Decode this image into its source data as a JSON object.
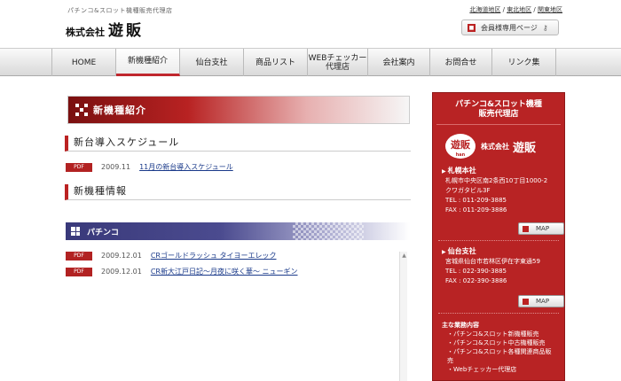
{
  "header": {
    "tagline": "パチンコ&スロット機種販売代理店",
    "company_prefix": "株式会社",
    "company_name": "遊販",
    "branches": [
      "北海道地区",
      "東北地区",
      "関東地区"
    ],
    "member_button": "会員様専用ページ"
  },
  "nav": {
    "items": [
      {
        "label": "HOME",
        "width": 72
      },
      {
        "label": "新機種紹介",
        "width": 72
      },
      {
        "label": "仙台支社",
        "width": 72
      },
      {
        "label": "商品リスト",
        "width": 72
      },
      {
        "label": "WEBチェッカー\n代理店",
        "width": 68
      },
      {
        "label": "会社案内",
        "width": 70
      },
      {
        "label": "お問合せ",
        "width": 70
      },
      {
        "label": "リンク集",
        "width": 72
      }
    ],
    "active_index": 1
  },
  "main": {
    "page_title": "新機種紹介",
    "schedule_title": "新台導入スケジュール",
    "pdf_label": "PDF",
    "schedule_rows": [
      {
        "date": "2009.11",
        "link": "11月の新台導入スケジュール"
      }
    ],
    "new_models_title": "新機種情報",
    "pachinko_label": "パチンコ",
    "pachinko_rows": [
      {
        "date": "2009.12.01",
        "link": "CRゴールドラッシュ タイヨーエレック"
      },
      {
        "date": "2009.12.01",
        "link": "CR新大江戸日記〜月夜に咲く華〜 ニューギン"
      }
    ]
  },
  "sidebar": {
    "heading_line1": "パチンコ&スロット機種",
    "heading_line2": "販売代理店",
    "logo_char": "遊販",
    "logo_sub": "han",
    "company_prefix": "株式会社",
    "company_name": "遊販",
    "offices": [
      {
        "name": "札幌本社",
        "address1": "札幌市中央区南2条西10丁目1000-2",
        "address2": "クワガタビル3F",
        "tel": "TEL : 011-209-3885",
        "fax": "FAX : 011-209-3886",
        "map": "MAP"
      },
      {
        "name": "仙台支社",
        "address1": "宮城県仙台市若林区伊在字東通59",
        "address2": "",
        "tel": "TEL : 022-390-3885",
        "fax": "FAX : 022-390-3886",
        "map": "MAP"
      }
    ],
    "services_title": "主な業務内容",
    "services": [
      "パチンコ&スロット新機種販売",
      "パチンコ&スロット中古機種販売",
      "パチンコ&スロット各種関連商品販売",
      "Webチェッカー代理店"
    ]
  },
  "colors": {
    "accent_red": "#b82324",
    "nav_active": "#c0272d",
    "pachinko_blue": "#39397a",
    "link": "#1a3a8a"
  }
}
